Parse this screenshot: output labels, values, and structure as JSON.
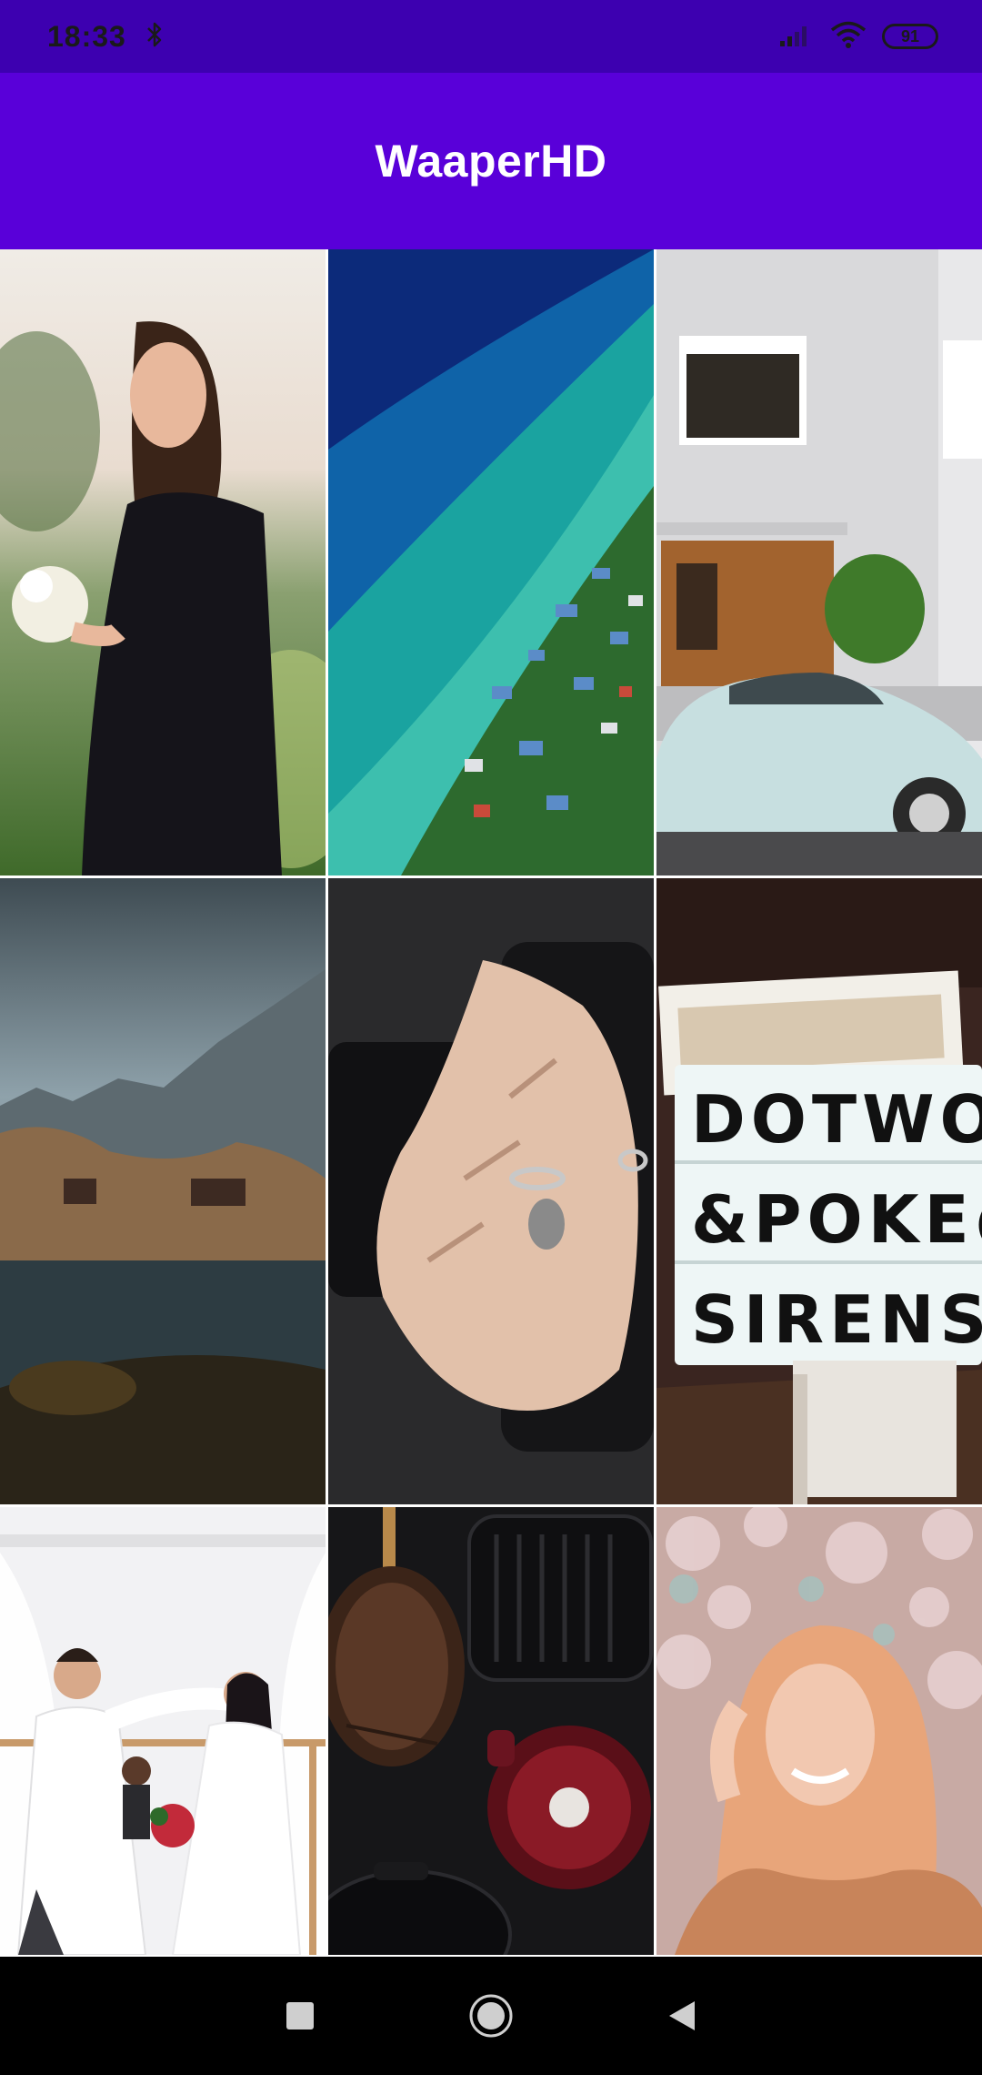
{
  "status_bar": {
    "time": "18:33",
    "battery": "91",
    "icons": [
      "bluetooth-icon",
      "signal-icon",
      "wifi-icon",
      "battery-icon"
    ]
  },
  "app_bar": {
    "title": "WaaperHD"
  },
  "wallpapers": [
    {
      "subject": "woman-flowers"
    },
    {
      "subject": "aerial-coast"
    },
    {
      "subject": "white-building-car"
    },
    {
      "subject": "mountain-lake"
    },
    {
      "subject": "hand-camera"
    },
    {
      "subject": "lightbox-sign",
      "sign_lines": [
        "DOTWOR",
        "&POKE@",
        "SIRENS"
      ]
    },
    {
      "subject": "wedding-couple"
    },
    {
      "subject": "cookware"
    },
    {
      "subject": "woman-blossoms"
    }
  ],
  "nav_bar": {
    "icons": [
      "recents-square-icon",
      "home-circle-icon",
      "back-triangle-icon"
    ]
  },
  "colors": {
    "status_bar": "#3d00b0",
    "app_bar": "#5900d9",
    "title": "#ffffff"
  }
}
